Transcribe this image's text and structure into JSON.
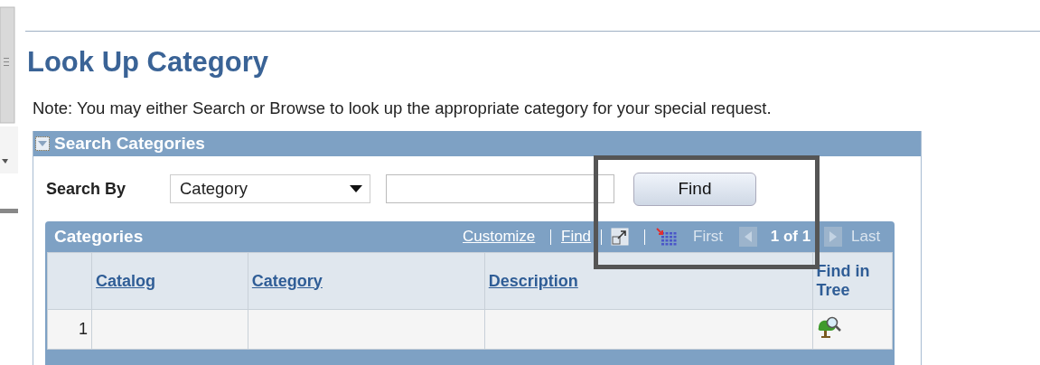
{
  "page": {
    "title": "Look Up Category",
    "note": "Note: You may either Search or Browse to look up the appropriate category for your special request."
  },
  "search_panel": {
    "title": "Search Categories",
    "expanded": true,
    "search_by_label": "Search By",
    "search_by_value": "Category",
    "find_button": "Find"
  },
  "grid": {
    "title": "Categories",
    "links": [
      "Customize",
      "Find"
    ],
    "pager": {
      "first": {
        "label": "First",
        "disabled": true
      },
      "position": "1 of 1",
      "last": {
        "label": "Last",
        "disabled": true
      }
    },
    "columns": [
      {
        "label": "Catalog",
        "sortable": true
      },
      {
        "label": "Category",
        "sortable": true
      },
      {
        "label": "Description",
        "sortable": true
      },
      {
        "label": "Find in Tree",
        "sortable": false
      }
    ],
    "rows": [
      {
        "number": "1"
      }
    ]
  }
}
